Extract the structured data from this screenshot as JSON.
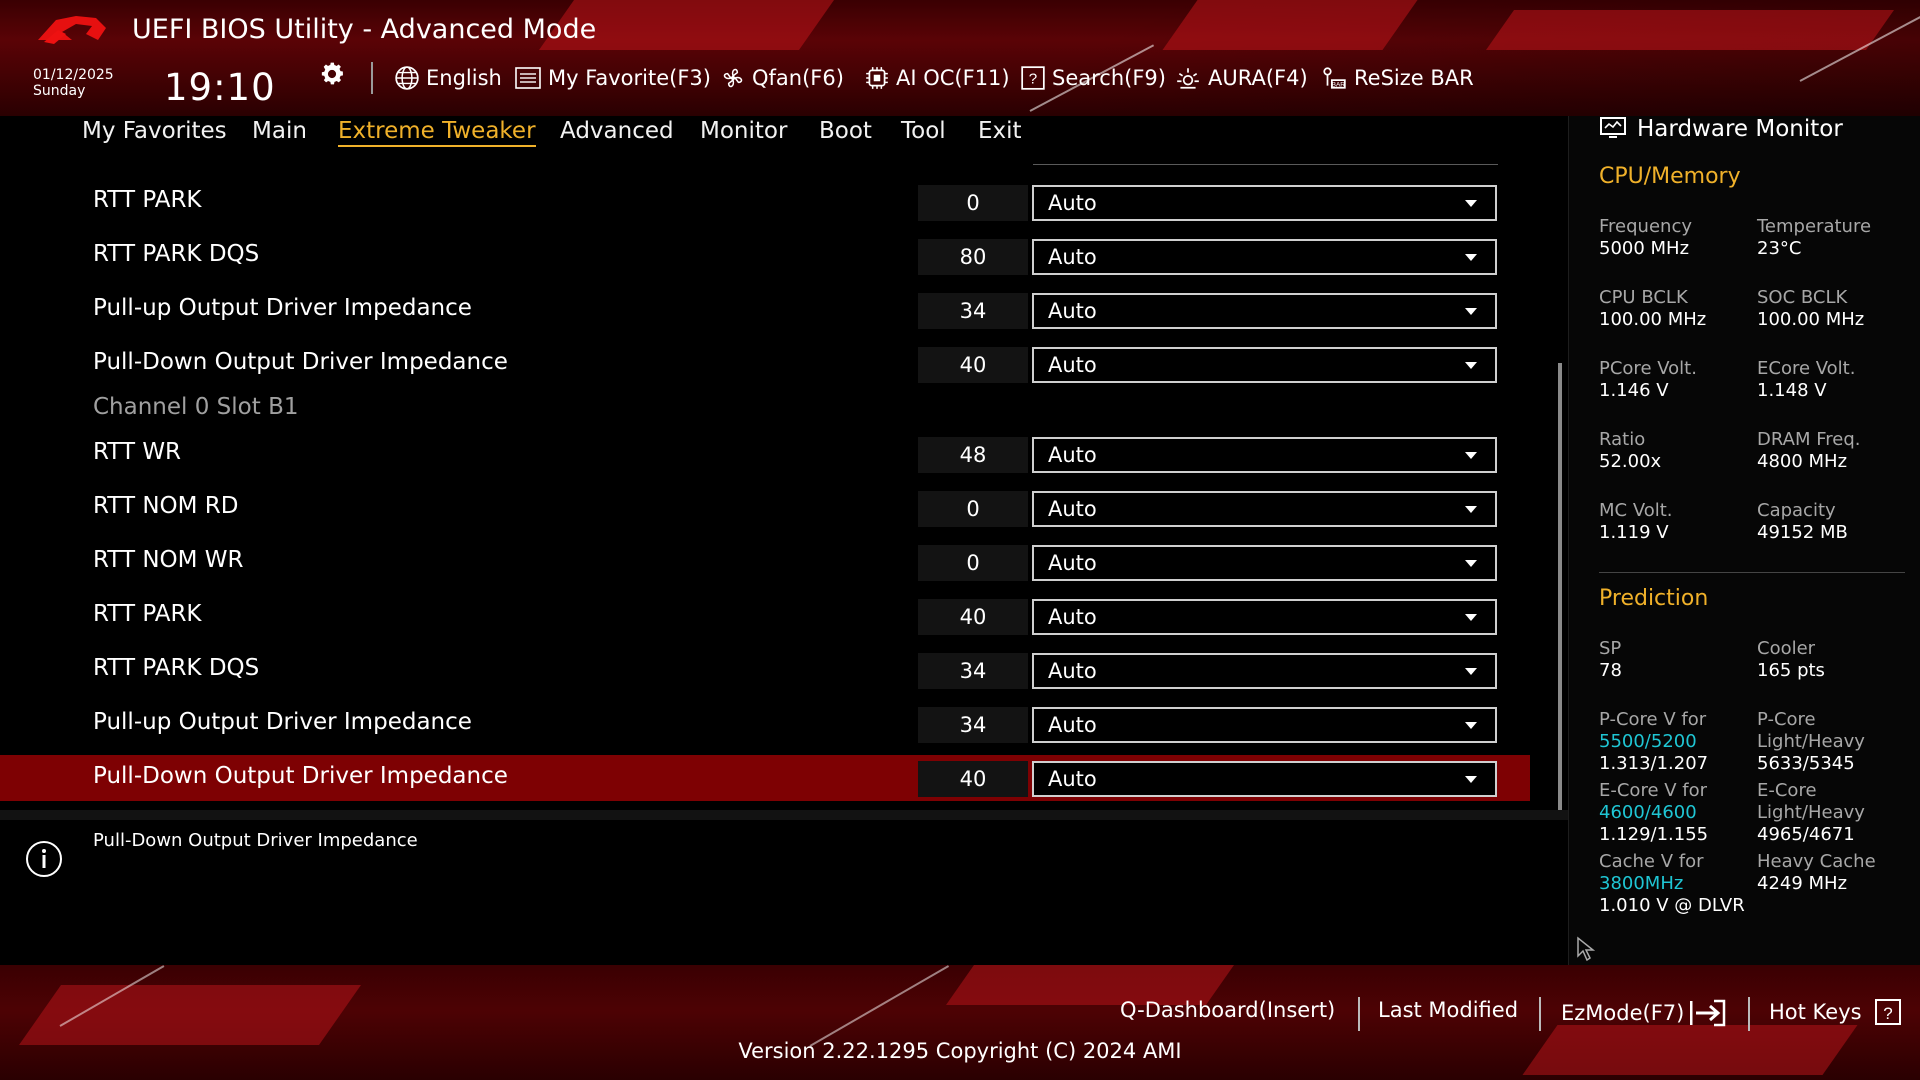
{
  "window": {
    "title": "UEFI BIOS Utility - Advanced Mode",
    "date": "01/12/2025",
    "day": "Sunday",
    "time": "19:10"
  },
  "toolbar": {
    "language": "English",
    "favorite": "My Favorite(F3)",
    "qfan": "Qfan(F6)",
    "aioc": "AI OC(F11)",
    "search": "Search(F9)",
    "aura": "AURA(F4)",
    "resizebar": "ReSize BAR"
  },
  "tabs": [
    "My Favorites",
    "Main",
    "Extreme Tweaker",
    "Advanced",
    "Monitor",
    "Boot",
    "Tool",
    "Exit"
  ],
  "active_tab": "Extreme Tweaker",
  "settings": {
    "rows": [
      {
        "label": "RTT PARK",
        "value": "0",
        "option": "Auto"
      },
      {
        "label": "RTT PARK DQS",
        "value": "80",
        "option": "Auto"
      },
      {
        "label": "Pull-up Output Driver Impedance",
        "value": "34",
        "option": "Auto"
      },
      {
        "label": "Pull-Down Output Driver Impedance",
        "value": "40",
        "option": "Auto"
      },
      {
        "label": "RTT WR",
        "value": "48",
        "option": "Auto"
      },
      {
        "label": "RTT NOM RD",
        "value": "0",
        "option": "Auto"
      },
      {
        "label": "RTT NOM WR",
        "value": "0",
        "option": "Auto"
      },
      {
        "label": "RTT PARK",
        "value": "40",
        "option": "Auto"
      },
      {
        "label": "RTT PARK DQS",
        "value": "34",
        "option": "Auto"
      },
      {
        "label": "Pull-up Output Driver Impedance",
        "value": "34",
        "option": "Auto"
      },
      {
        "label": "Pull-Down Output Driver Impedance",
        "value": "40",
        "option": "Auto"
      }
    ],
    "section_label": "Channel 0 Slot B1",
    "selected_index": 10
  },
  "help": {
    "text": "Pull-Down Output Driver Impedance"
  },
  "hardware_monitor": {
    "title": "Hardware Monitor",
    "cpu_memory_title": "CPU/Memory",
    "cpu": [
      {
        "k": "Frequency",
        "v": "5000 MHz"
      },
      {
        "k": "Temperature",
        "v": "23°C"
      },
      {
        "k": "CPU BCLK",
        "v": "100.00 MHz"
      },
      {
        "k": "SOC BCLK",
        "v": "100.00 MHz"
      },
      {
        "k": "PCore Volt.",
        "v": "1.146 V"
      },
      {
        "k": "ECore Volt.",
        "v": "1.148 V"
      },
      {
        "k": "Ratio",
        "v": "52.00x"
      },
      {
        "k": "DRAM Freq.",
        "v": "4800 MHz"
      },
      {
        "k": "MC Volt.",
        "v": "1.119 V"
      },
      {
        "k": "Capacity",
        "v": "49152 MB"
      }
    ],
    "prediction_title": "Prediction",
    "sp_label": "SP",
    "sp_value": "78",
    "cooler_label": "Cooler",
    "cooler_value": "165 pts",
    "pcore_v_label": "P-Core V for",
    "pcore_v_freq": "5500/5200",
    "pcore_v_value": "1.313/1.207",
    "pcore_lh_label1": "P-Core",
    "pcore_lh_label2": "Light/Heavy",
    "pcore_lh_value": "5633/5345",
    "ecore_v_label": "E-Core V for",
    "ecore_v_freq": "4600/4600",
    "ecore_v_value": "1.129/1.155",
    "ecore_lh_label1": "E-Core",
    "ecore_lh_label2": "Light/Heavy",
    "ecore_lh_value": "4965/4671",
    "cache_v_label": "Cache V for",
    "cache_v_freq": "3800MHz",
    "cache_v_value": "1.010 V @ DLVR",
    "heavy_cache_label": "Heavy Cache",
    "heavy_cache_value": "4249 MHz"
  },
  "footer": {
    "qdashboard": "Q-Dashboard(Insert)",
    "last_modified": "Last Modified",
    "ezmode": "EzMode(F7)",
    "hotkeys": "Hot Keys",
    "version": "Version 2.22.1295 Copyright (C) 2024 AMI"
  },
  "colors": {
    "accent": "#f0b12a",
    "selected_row": "#7e0103",
    "cyan": "#1fc6d4",
    "header_red": "#5a0306"
  }
}
